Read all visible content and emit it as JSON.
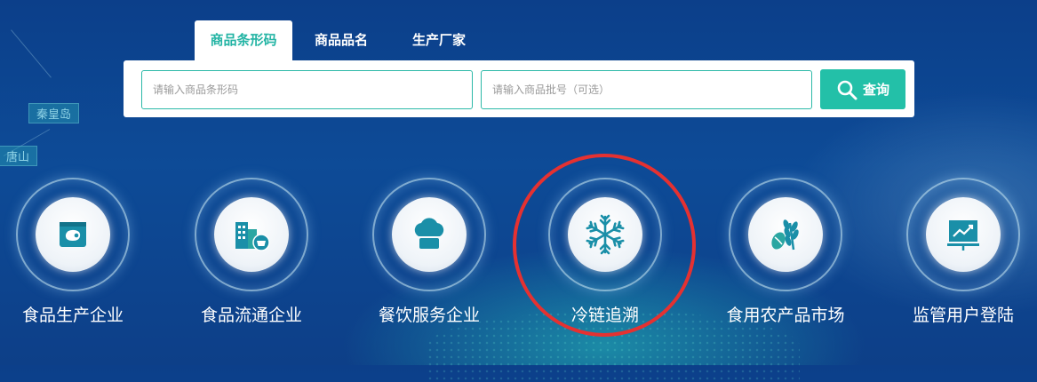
{
  "tabs": [
    {
      "label": "商品条形码",
      "active": true
    },
    {
      "label": "商品品名",
      "active": false
    },
    {
      "label": "生产厂家",
      "active": false
    }
  ],
  "search": {
    "barcode_placeholder": "请输入商品条形码",
    "batch_placeholder": "请输入商品批号（可选）",
    "button_label": "查询",
    "button_icon": "search-icon"
  },
  "map_labels": [
    "秦皇岛",
    "唐山"
  ],
  "categories": [
    {
      "label": "食品生产企业",
      "icon": "meat-package-icon"
    },
    {
      "label": "食品流通企业",
      "icon": "store-basket-icon"
    },
    {
      "label": "餐饮服务企业",
      "icon": "chef-hat-icon"
    },
    {
      "label": "冷链追溯",
      "icon": "snowflake-icon",
      "highlighted": true
    },
    {
      "label": "食用农产品市场",
      "icon": "grain-icon"
    },
    {
      "label": "监管用户登陆",
      "icon": "chart-board-icon"
    }
  ],
  "colors": {
    "accent": "#23c0a8",
    "highlight_ring": "#e53131",
    "icon_teal": "#1a8fa8",
    "background": "#0d4b97"
  }
}
